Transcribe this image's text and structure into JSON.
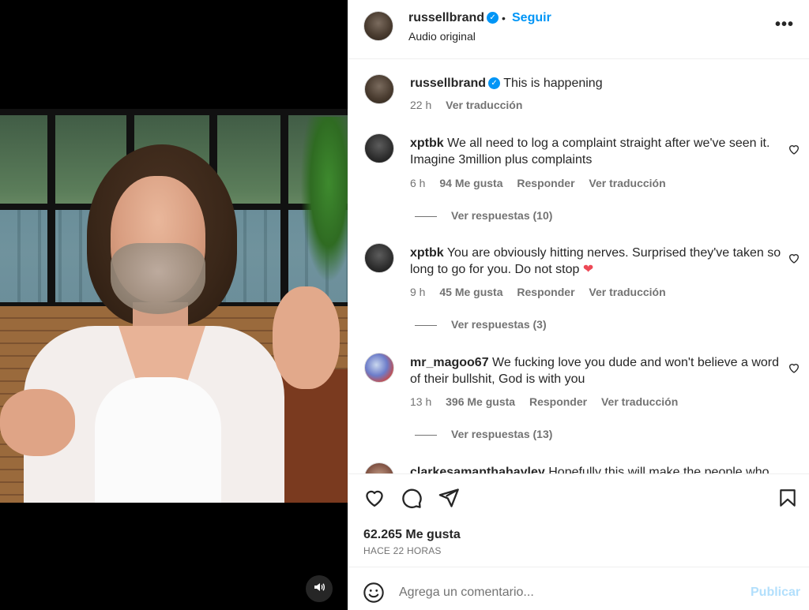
{
  "post": {
    "username": "russellbrand",
    "follow_label": "Seguir",
    "separator": "•",
    "audio": "Audio original",
    "more_label": "•••"
  },
  "caption": {
    "username": "russellbrand",
    "text": "This is happening",
    "time": "22 h",
    "translate": "Ver traducción"
  },
  "comments": [
    {
      "username": "xptbk",
      "text": "We all need to log a complaint straight after we've seen it. Imagine 3million plus complaints",
      "time": "6 h",
      "likes": "94 Me gusta",
      "reply": "Responder",
      "translate": "Ver traducción",
      "replies": "Ver respuestas (10)"
    },
    {
      "username": "xptbk",
      "text": "You are obviously hitting nerves. Surprised they've taken so long to go for you. Do not stop",
      "emoji": "❤",
      "time": "9 h",
      "likes": "45 Me gusta",
      "reply": "Responder",
      "translate": "Ver traducción",
      "replies": "Ver respuestas (3)"
    },
    {
      "username": "mr_magoo67",
      "text": "We fucking love you dude and won't believe a word of their bullshit, God is with you",
      "time": "13 h",
      "likes": "396 Me gusta",
      "reply": "Responder",
      "translate": "Ver traducción",
      "replies": "Ver respuestas (13)"
    },
    {
      "username": "clarkesamanthahayley",
      "text": "Hopefully this will make the people who"
    }
  ],
  "stats": {
    "likes": "62.265 Me gusta",
    "posted": "HACE 22 HORAS"
  },
  "composer": {
    "placeholder": "Agrega un comentario...",
    "post_label": "Publicar"
  },
  "colors": {
    "accent": "#0095f6",
    "muted_text": "#737373",
    "post_disabled": "#b2dffc",
    "heart_red": "#ed4956"
  },
  "icons": {
    "like": "heart-outline-icon",
    "comment": "speech-bubble-icon",
    "share": "paper-plane-icon",
    "save": "bookmark-icon",
    "emoji": "smiley-icon",
    "sound": "speaker-icon"
  }
}
